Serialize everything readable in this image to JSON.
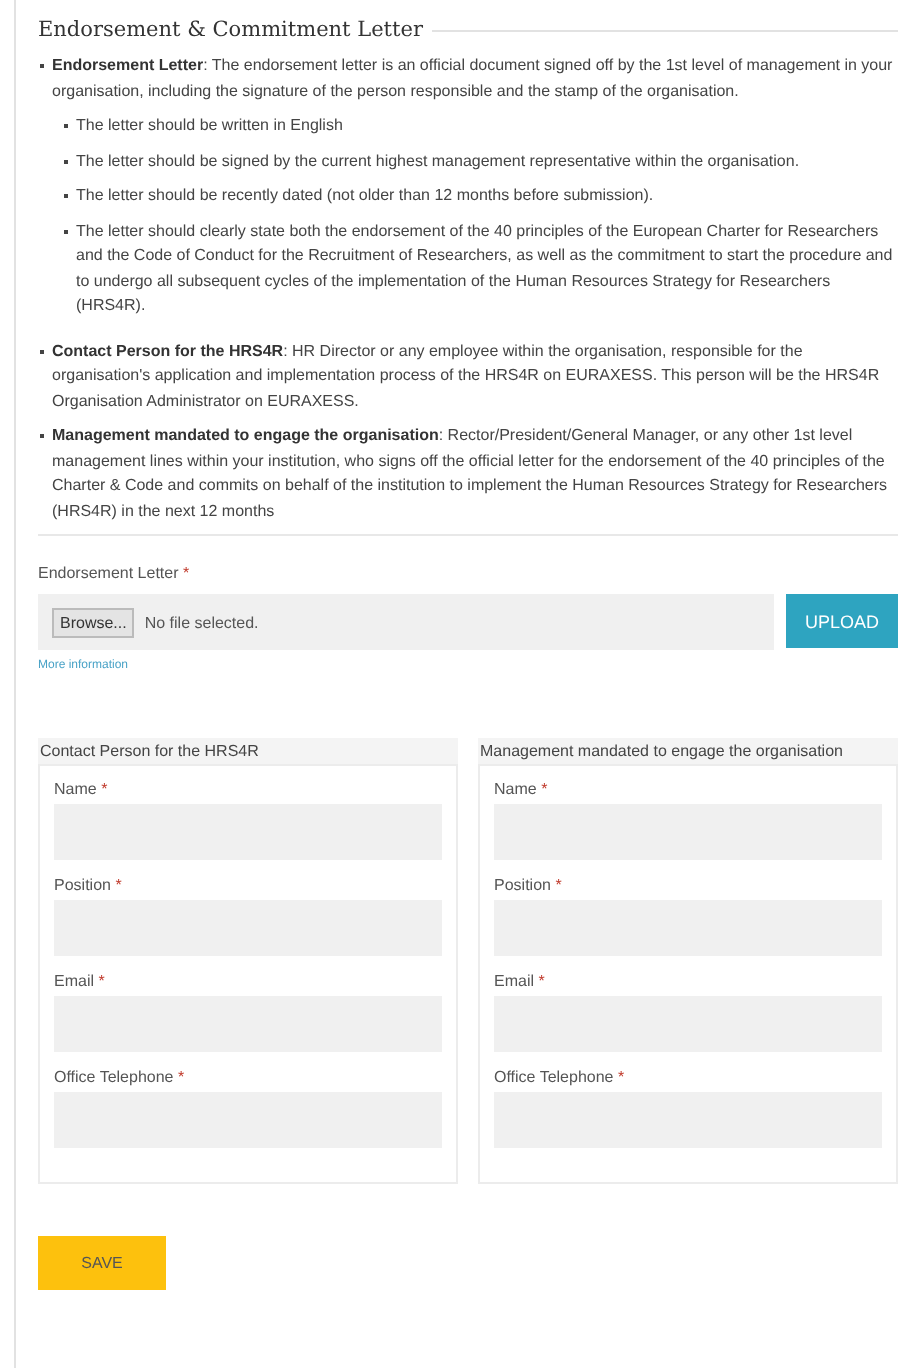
{
  "section": {
    "title": "Endorsement & Commitment Letter"
  },
  "notes": [
    {
      "text": "**Endorsement Letter**: The endorsement letter is an official document signed off by the 1st level of management in your organisation, including the signature of the person responsible and the stamp of the organisation.",
      "children": [
        {
          "text": "The letter should be written in English"
        },
        {
          "text": "The letter should be signed by the current highest management representative within the organisation."
        },
        {
          "text": "The letter should be recently dated (not older than 12 months before submission)."
        },
        {
          "text": "The letter should clearly state both the endorsement of the 40 principles of the European Charter for Researchers and the Code of Conduct for the Recruitment of Researchers, as well as the commitment to start the procedure and to undergo all subsequent cycles of the implementation of the Human Resources Strategy for Researchers (HRS4R)."
        }
      ]
    },
    {
      "text": "**Contact Person for the HRS4R**: HR Director or any employee within the organisation, responsible for the organisation's application and implementation process of the HRS4R on EURAXESS. This person will be the HRS4R Organisation Administrator on EURAXESS."
    },
    {
      "text": "**Management mandated to engage the organisation**: Rector/President/General Manager, or any other 1st level management lines within your institution, who signs off the official letter for the endorsement of the 40 principles of the Charter & Code and commits on behalf of the institution to implement the Human Resources Strategy for Researchers (HRS4R) in the next 12 months"
    }
  ],
  "upload": {
    "label": "Endorsement Letter",
    "required_mark": "*",
    "browse_button": "Browse...",
    "file_status": "No file selected.",
    "upload_button": "UPLOAD",
    "more_link": "More information"
  },
  "panels": [
    {
      "title": "Contact Person for the HRS4R",
      "fields": [
        {
          "label": "Name",
          "required_mark": "*"
        },
        {
          "label": "Position",
          "required_mark": "*"
        },
        {
          "label": "Email",
          "required_mark": "*"
        },
        {
          "label": "Office Telephone",
          "required_mark": "*"
        }
      ]
    },
    {
      "title": "Management mandated to engage the organisation",
      "fields": [
        {
          "label": "Name",
          "required_mark": "*"
        },
        {
          "label": "Position",
          "required_mark": "*"
        },
        {
          "label": "Email",
          "required_mark": "*"
        },
        {
          "label": "Office Telephone",
          "required_mark": "*"
        }
      ]
    }
  ],
  "save_button": "SAVE"
}
